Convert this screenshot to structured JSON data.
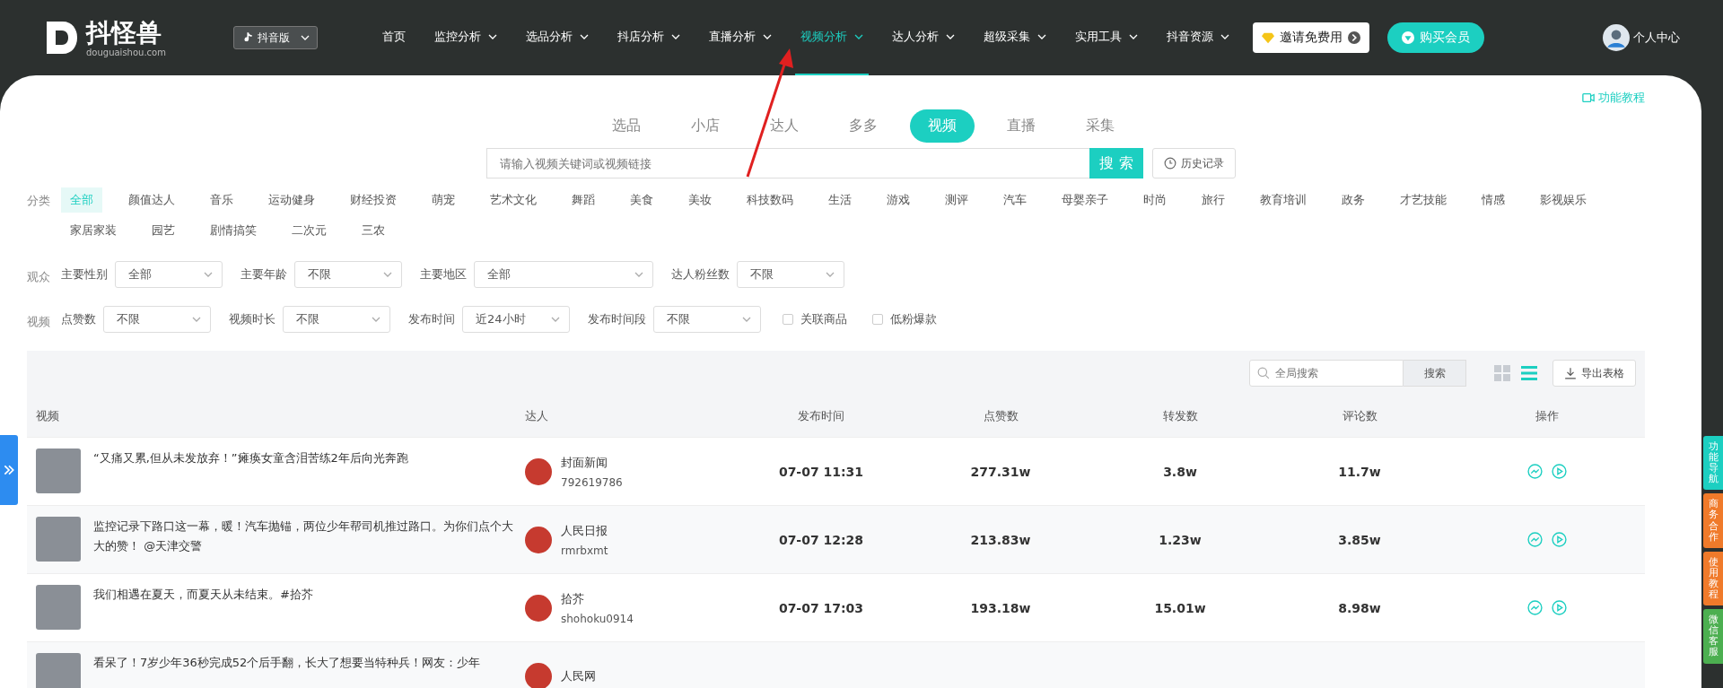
{
  "nav": {
    "logo": "抖怪兽",
    "domain": "douguaishou.com",
    "platform": "抖音版",
    "menu": [
      {
        "label": "首页",
        "dropdown": false,
        "selected": false
      },
      {
        "label": "监控分析",
        "dropdown": true,
        "selected": false
      },
      {
        "label": "选品分析",
        "dropdown": true,
        "selected": false
      },
      {
        "label": "抖店分析",
        "dropdown": true,
        "selected": false
      },
      {
        "label": "直播分析",
        "dropdown": true,
        "selected": false
      },
      {
        "label": "视频分析",
        "dropdown": true,
        "selected": true
      },
      {
        "label": "达人分析",
        "dropdown": true,
        "selected": false
      },
      {
        "label": "超级采集",
        "dropdown": true,
        "selected": false
      },
      {
        "label": "实用工具",
        "dropdown": true,
        "selected": false
      },
      {
        "label": "抖音资源",
        "dropdown": true,
        "selected": false
      }
    ],
    "invite": "邀请免费用",
    "buy": "购买会员",
    "user": "个人中心"
  },
  "tutorial_link": "功能教程",
  "type_tabs": [
    {
      "label": "选品",
      "selected": false
    },
    {
      "label": "小店",
      "selected": false
    },
    {
      "label": "达人",
      "selected": false
    },
    {
      "label": "多多",
      "selected": false
    },
    {
      "label": "视频",
      "selected": true
    },
    {
      "label": "直播",
      "selected": false
    },
    {
      "label": "采集",
      "selected": false
    }
  ],
  "search": {
    "placeholder": "请输入视频关键词或视频链接",
    "button": "搜 索",
    "history": "历史记录"
  },
  "categories": {
    "label": "分类",
    "items": [
      {
        "label": "全部",
        "selected": true
      },
      {
        "label": "颜值达人",
        "selected": false
      },
      {
        "label": "音乐",
        "selected": false
      },
      {
        "label": "运动健身",
        "selected": false
      },
      {
        "label": "财经投资",
        "selected": false
      },
      {
        "label": "萌宠",
        "selected": false
      },
      {
        "label": "艺术文化",
        "selected": false
      },
      {
        "label": "舞蹈",
        "selected": false
      },
      {
        "label": "美食",
        "selected": false
      },
      {
        "label": "美妆",
        "selected": false
      },
      {
        "label": "科技数码",
        "selected": false
      },
      {
        "label": "生活",
        "selected": false
      },
      {
        "label": "游戏",
        "selected": false
      },
      {
        "label": "测评",
        "selected": false
      },
      {
        "label": "汽车",
        "selected": false
      },
      {
        "label": "母婴亲子",
        "selected": false
      },
      {
        "label": "时尚",
        "selected": false
      },
      {
        "label": "旅行",
        "selected": false
      },
      {
        "label": "教育培训",
        "selected": false
      },
      {
        "label": "政务",
        "selected": false
      },
      {
        "label": "才艺技能",
        "selected": false
      },
      {
        "label": "情感",
        "selected": false
      },
      {
        "label": "影视娱乐",
        "selected": false
      },
      {
        "label": "家居家装",
        "selected": false
      },
      {
        "label": "园艺",
        "selected": false
      },
      {
        "label": "剧情搞笑",
        "selected": false
      },
      {
        "label": "二次元",
        "selected": false
      },
      {
        "label": "三农",
        "selected": false
      }
    ]
  },
  "audience_filters": {
    "label": "观众",
    "filters": [
      {
        "label": "主要性别",
        "value": "全部"
      },
      {
        "label": "主要年龄",
        "value": "不限"
      },
      {
        "label": "主要地区",
        "value": "全部"
      },
      {
        "label": "达人粉丝数",
        "value": "不限"
      }
    ]
  },
  "video_filters": {
    "label": "视频",
    "filters": [
      {
        "label": "点赞数",
        "value": "不限"
      },
      {
        "label": "视频时长",
        "value": "不限"
      },
      {
        "label": "发布时间",
        "value": "近24小时"
      },
      {
        "label": "发布时间段",
        "value": "不限"
      }
    ],
    "checkboxes": [
      {
        "label": "关联商品",
        "checked": false
      },
      {
        "label": "低粉爆款",
        "checked": false
      }
    ]
  },
  "toolbar": {
    "search_placeholder": "全局搜索",
    "search_button": "搜索",
    "views": [
      {
        "kind": "grid",
        "selected": false
      },
      {
        "kind": "list",
        "selected": true
      }
    ],
    "export": "导出表格"
  },
  "table": {
    "columns": [
      "视频",
      "达人",
      "发布时间",
      "点赞数",
      "转发数",
      "评论数",
      "操作"
    ],
    "rows": [
      {
        "title": "“又痛又累,但从未发放弃！”瘫痪女童含泪苦练2年后向光奔跑",
        "author": "封面新闻",
        "author_id": "792619786",
        "time": "07-07 11:31",
        "likes": "277.31w",
        "shares": "3.8w",
        "comments": "11.7w"
      },
      {
        "title": "监控记录下路口这一幕，暖！汽车抛锚，两位少年帮司机推过路口。为你们点个大大的赞！ @天津交警",
        "author": "人民日报",
        "author_id": "rmrbxmt",
        "time": "07-07 12:28",
        "likes": "213.83w",
        "shares": "1.23w",
        "comments": "3.85w"
      },
      {
        "title": "我们相遇在夏天，而夏天从未结束。#拾芥",
        "author": "拾芥",
        "author_id": "shohoku0914",
        "time": "07-07 17:03",
        "likes": "193.18w",
        "shares": "15.01w",
        "comments": "8.98w"
      },
      {
        "title": "看呆了！7岁少年36秒完成52个后手翻，长大了想要当特种兵！网友：少年",
        "author": "人民网",
        "author_id": "",
        "time": "",
        "likes": "",
        "shares": "",
        "comments": ""
      }
    ]
  },
  "side_tabs": [
    {
      "label": "功能导航",
      "color": "#1ccfc1"
    },
    {
      "label": "商务合作",
      "color": "#f07a2a"
    },
    {
      "label": "使用教程",
      "color": "#f07a2a"
    },
    {
      "label": "微信客服",
      "color": "#4caf50"
    }
  ]
}
